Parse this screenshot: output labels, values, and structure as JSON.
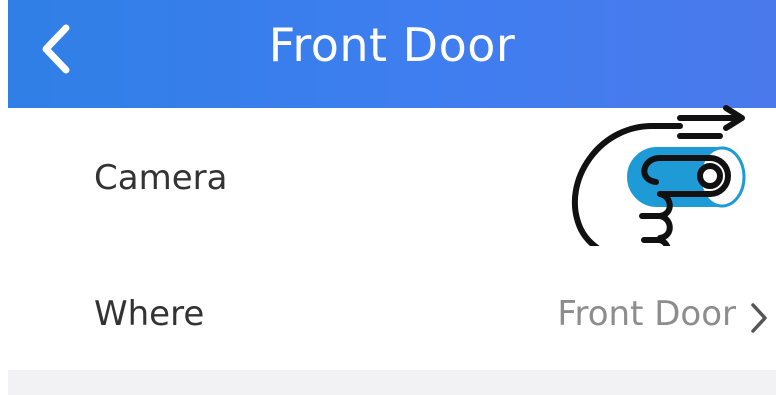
{
  "header": {
    "title": "Front Door",
    "back_icon": "chevron-left-icon",
    "color": "#3a7fe9"
  },
  "rows": {
    "camera": {
      "label": "Camera",
      "toggle_state": "on",
      "toggle_color": "#1e9bd7",
      "gesture_icon": "hand-swipe-right-icon"
    },
    "where": {
      "label": "Where",
      "value": "Front Door",
      "chevron_icon": "chevron-right-icon"
    }
  }
}
